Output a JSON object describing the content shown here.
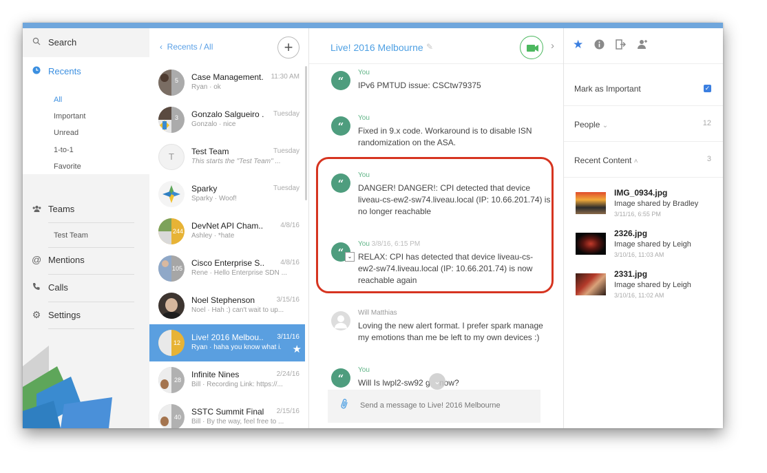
{
  "nav": {
    "search": "Search",
    "recents": "Recents",
    "recents_sub": [
      "All",
      "Important",
      "Unread",
      "1-to-1",
      "Favorite"
    ],
    "teams": "Teams",
    "teams_sub": [
      "Test Team"
    ],
    "mentions": "Mentions",
    "calls": "Calls",
    "settings": "Settings"
  },
  "list": {
    "breadcrumb": "Recents / All",
    "conversations": [
      {
        "name": "Case Management...",
        "time": "11:30 AM",
        "preview": "Ryan · ok",
        "badge": "5"
      },
      {
        "name": "Gonzalo Salgueiro ...",
        "time": "Tuesday",
        "preview": "Gonzalo · nice",
        "badge": "3"
      },
      {
        "name": "Test Team",
        "time": "Tuesday",
        "preview": "This starts the \"Test Team\" ...",
        "initial": "T"
      },
      {
        "name": "Sparky",
        "time": "Tuesday",
        "preview": "Sparky · Woof!"
      },
      {
        "name": "DevNet API Cham...",
        "time": "4/8/16",
        "preview": "Ashley · *hate",
        "badge": "244"
      },
      {
        "name": "Cisco Enterprise S...",
        "time": "4/8/16",
        "preview": "Rene · Hello Enterprise SDN ...",
        "badge": "105"
      },
      {
        "name": "Noel Stephenson",
        "time": "3/15/16",
        "preview": "Noel · Hah :) can't wait to up..."
      },
      {
        "name": "Live! 2016 Melbou...",
        "time": "3/11/16",
        "preview": "Ryan · haha you know what i...",
        "badge": "12"
      },
      {
        "name": "Infinite Nines",
        "time": "2/24/16",
        "preview": "Bill · Recording Link: https://...",
        "badge": "28"
      },
      {
        "name": "SSTC Summit Final...",
        "time": "2/15/16",
        "preview": "Bill · By the way, feel free to ...",
        "badge": "40"
      }
    ]
  },
  "chat": {
    "title": "Live! 2016 Melbourne",
    "messages": [
      {
        "sender": "You",
        "stamp": "",
        "text": "IPv6 PMTUD issue: CSCtw79375"
      },
      {
        "sender": "You",
        "stamp": "",
        "text": "Fixed in 9.x code.  Workaround is to disable ISN randomization on the ASA."
      },
      {
        "sender": "You",
        "stamp": "",
        "text": "DANGER! DANGER!: CPI detected that device liveau-cs-ew2-sw74.liveau.local (IP: 10.66.201.74) is no longer reachable"
      },
      {
        "sender": "You",
        "stamp": "3/8/16, 6:15 PM",
        "text": "RELAX: CPI has detected that device liveau-cs-ew2-sw74.liveau.local (IP: 10.66.201.74) is now reachable again"
      },
      {
        "sender": "Will Matthias",
        "stamp": "",
        "text": "Loving the new alert format. I prefer spark manage my emotions than me be left to my own devices :)"
      },
      {
        "sender": "You",
        "stamp": "",
        "text": "Will Is lwpl2-sw92 g    now?"
      }
    ],
    "composer_placeholder": "Send a message to Live! 2016 Melbourne"
  },
  "right": {
    "mark_important": "Mark as Important",
    "people_label": "People",
    "people_count": "12",
    "recent_content_label": "Recent Content",
    "recent_content_count": "3",
    "files": [
      {
        "name": "IMG_0934.jpg",
        "desc": "Image shared by Bradley",
        "date": "3/11/16, 6:55 PM"
      },
      {
        "name": "2326.jpg",
        "desc": "Image shared by Leigh",
        "date": "3/10/16, 11:03 AM"
      },
      {
        "name": "2331.jpg",
        "desc": "Image shared by Leigh",
        "date": "3/10/16, 11:02 AM"
      }
    ]
  },
  "colors": {
    "accent": "#4fa0e3",
    "selected_row": "#5a9fe0",
    "message_green": "#4e9d7e",
    "highlight_red": "#d63420"
  }
}
